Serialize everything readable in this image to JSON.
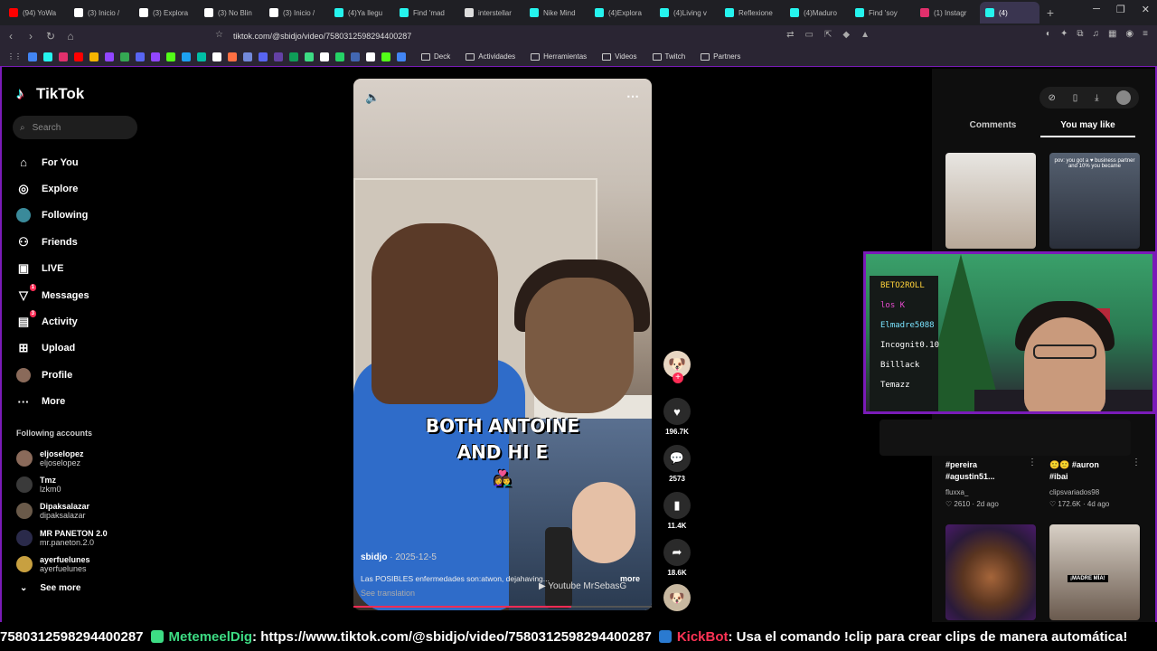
{
  "browser": {
    "tabs": [
      {
        "label": "(94) YoWa",
        "color": "#ff0000"
      },
      {
        "label": "(3) Inicio /",
        "color": "#ffffff"
      },
      {
        "label": "(3) Explora",
        "color": "#ffffff"
      },
      {
        "label": "(3) No Blin",
        "color": "#ffffff"
      },
      {
        "label": "(3) Inicio /",
        "color": "#ffffff"
      },
      {
        "label": "(4)Ya llegu",
        "color": "#25f4ee"
      },
      {
        "label": "Find 'mad",
        "color": "#25f4ee"
      },
      {
        "label": "interstellar",
        "color": "#dddddd"
      },
      {
        "label": "Nike Mind",
        "color": "#25f4ee"
      },
      {
        "label": "(4)Explora",
        "color": "#25f4ee"
      },
      {
        "label": "(4)Living v",
        "color": "#25f4ee"
      },
      {
        "label": "Reflexione",
        "color": "#25f4ee"
      },
      {
        "label": "(4)Maduro",
        "color": "#25f4ee"
      },
      {
        "label": "Find 'soy",
        "color": "#25f4ee"
      },
      {
        "label": "(1) Instagr",
        "color": "#e1306c"
      },
      {
        "label": "(4)",
        "color": "#25f4ee"
      }
    ],
    "new_tab": "+",
    "url": "tiktok.com/@sbidjo/video/7580312598294400287",
    "bookmarks": {
      "folders": [
        "Deck",
        "Actividades",
        "Herramientas",
        "Videos",
        "Twitch",
        "Partners"
      ],
      "icon_colors": [
        "#4285f4",
        "#25f4ee",
        "#e1306c",
        "#ff0000",
        "#f4b400",
        "#9146ff",
        "#34a853",
        "#5865f2",
        "#9146ff",
        "#53fc18",
        "#1da1f2",
        "#00bfa5",
        "#ffffff",
        "#ff7043",
        "#7289da",
        "#5865f2",
        "#6441a5",
        "#0f9d58",
        "#3ddc84",
        "#ffffff",
        "#25d366",
        "#4267b2",
        "#ffffff",
        "#53fc18",
        "#4285f4"
      ]
    }
  },
  "sidebar": {
    "logo": "TikTok",
    "search_placeholder": "Search",
    "nav": [
      {
        "label": "For You",
        "icon": "home-icon",
        "glyph": "⌂"
      },
      {
        "label": "Explore",
        "icon": "compass-icon",
        "glyph": "◎"
      },
      {
        "label": "Following",
        "icon": "following-avatar-icon",
        "glyph": "●"
      },
      {
        "label": "Friends",
        "icon": "friends-icon",
        "glyph": "⚇"
      },
      {
        "label": "LIVE",
        "icon": "live-icon",
        "glyph": "▣"
      },
      {
        "label": "Messages",
        "icon": "messages-icon",
        "glyph": "▽",
        "badge": "1"
      },
      {
        "label": "Activity",
        "icon": "activity-icon",
        "glyph": "▤",
        "badge": "3"
      },
      {
        "label": "Upload",
        "icon": "upload-icon",
        "glyph": "⊞"
      },
      {
        "label": "Profile",
        "icon": "profile-avatar-icon",
        "glyph": "●"
      },
      {
        "label": "More",
        "icon": "more-icon",
        "glyph": "···"
      }
    ],
    "following_title": "Following accounts",
    "accounts": [
      {
        "name": "eljoselopez",
        "handle": "eljoselopez",
        "color": "#8a6a5a"
      },
      {
        "name": "Tmz",
        "handle": "lzkm0",
        "color": "#3a3a3a"
      },
      {
        "name": "Dipaksalazar",
        "handle": "dipaksalazar",
        "color": "#6a5a4a"
      },
      {
        "name": "MR PANETON 2.0",
        "handle": "mr.paneton.2.0",
        "color": "#2a2a4a"
      },
      {
        "name": "ayerfuelunes",
        "handle": "ayerfuelunes",
        "color": "#c8a040"
      }
    ],
    "see_more": "See more"
  },
  "video": {
    "overlay_text_line1": "BOTH ANTOINE",
    "overlay_text_line2": "AND HI   E",
    "emoji": "👩‍❤️‍👨",
    "author": "sbidjo",
    "date": " · 2025-12-5",
    "description": "Las POSIBLES enfermedades son:atwon, dejahaving...",
    "more": "more",
    "see_translation": "See translation",
    "watermark": "▶ Youtube MrSebasG",
    "progress": 0.73
  },
  "actions": {
    "likes": "196.7K",
    "comments": "2573",
    "saves": "11.4K",
    "shares": "18.6K"
  },
  "right_panel": {
    "tabs": [
      "Comments",
      "You may like"
    ],
    "active_tab": "You may like",
    "thumb_overlay_text": "pov: you got a ♥ business partner and 10% you became",
    "items": [
      {
        "title_line1": "#pereira",
        "title_line2": "#agustin51...",
        "author": "fluxxa_",
        "likes": "2610",
        "age": "2d ago"
      },
      {
        "title_line1": "🙂🙂 #auron",
        "title_line2": "#ibai",
        "author": "clipsvariados98",
        "likes": "172.6K",
        "age": "4d ago"
      }
    ],
    "bottom_thumb_label": "¡MADRE MÍA!"
  },
  "webcam": {
    "chalk_lines": [
      "BETO2ROLL",
      "los K",
      "Elmadre5088",
      "Incognit0.10",
      "Billlack",
      "Temazz"
    ]
  },
  "ticker": {
    "prefix": "7580312598294400287",
    "user1": "MetemeelDig",
    "msg1": ": https://www.tiktok.com/@sbidjo/video/7580312598294400287",
    "user2": "KickBot",
    "msg2": ": Usa el comando !clip para crear clips de manera automática!"
  }
}
